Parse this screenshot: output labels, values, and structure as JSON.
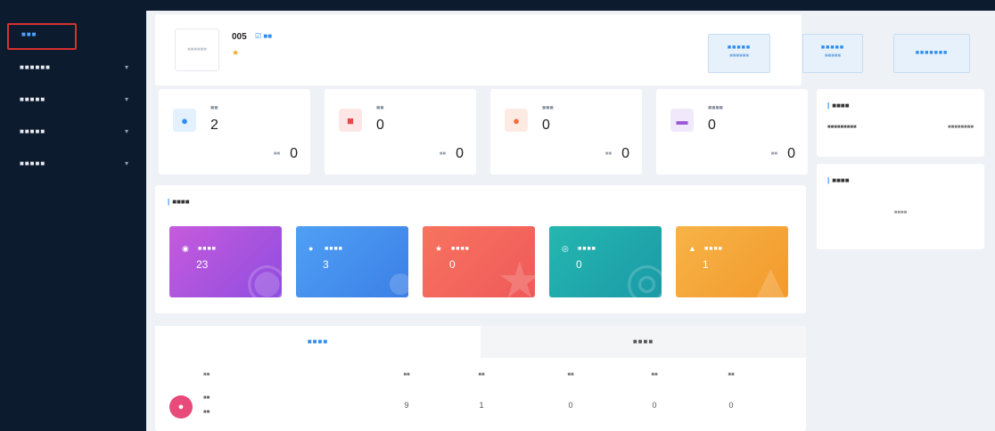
{
  "sidebar": {
    "home_label": "■■■",
    "items": [
      {
        "label": "■■■■■■",
        "chevron": "▾"
      },
      {
        "label": "■■■■■",
        "chevron": "▾"
      },
      {
        "label": "■■■■■",
        "chevron": "▾"
      },
      {
        "label": "■■■■■",
        "chevron": "▾"
      }
    ]
  },
  "shop": {
    "logo_text": "■■■■■■",
    "name": "005",
    "edit_label": "☑ ■■",
    "rating": "★"
  },
  "top_buttons": [
    {
      "line1": "■■■■■",
      "line2": "■■■■■■"
    },
    {
      "line1": "■■■■■",
      "line2": "■■■■■"
    },
    {
      "line1": "■■■■■■■",
      "line2": ""
    }
  ],
  "stats": [
    {
      "name": "■■",
      "value": "2",
      "sub_label": "■■",
      "sub_value": "0",
      "icon": "eye-icon",
      "glyph": "●",
      "color": "#2d8cf0",
      "bg": "#e3f0fd"
    },
    {
      "name": "■■",
      "value": "0",
      "sub_label": "■■",
      "sub_value": "0",
      "icon": "gift-icon",
      "glyph": "■",
      "color": "#e84a4a",
      "bg": "#fde6e6"
    },
    {
      "name": "■■■",
      "value": "0",
      "sub_label": "■■",
      "sub_value": "0",
      "icon": "user-icon",
      "glyph": "●",
      "color": "#f56b3c",
      "bg": "#fdeae3"
    },
    {
      "name": "■■■■",
      "value": "0",
      "sub_label": "■■",
      "sub_value": "0",
      "icon": "chat-icon",
      "glyph": "▬",
      "color": "#9b59d6",
      "bg": "#f1e8fb"
    }
  ],
  "system_notice": {
    "title": "■■■■",
    "row_text": "■■■■■■■■■",
    "date": "■■■■■■■■"
  },
  "contact": {
    "title": "■■■■",
    "empty_text": "■■■■"
  },
  "analysis": {
    "title": "■■■■",
    "tiles": [
      {
        "label": "■■■■",
        "value": "23",
        "icon": "eye-icon",
        "glyph": "◉",
        "grad": "linear-gradient(135deg,#c65bdc,#8f4de0)"
      },
      {
        "label": "■■■■",
        "value": "3",
        "icon": "user-icon",
        "glyph": "●",
        "grad": "linear-gradient(135deg,#4fa0f5,#3c7fe6)"
      },
      {
        "label": "■■■■",
        "value": "0",
        "icon": "star-icon",
        "glyph": "★",
        "grad": "linear-gradient(135deg,#f7735f,#ef5a5a)"
      },
      {
        "label": "■■■■",
        "value": "0",
        "icon": "share-icon",
        "glyph": "◎",
        "grad": "linear-gradient(135deg,#25b7b0,#1a9aa7)"
      },
      {
        "label": "■■■■",
        "value": "1",
        "icon": "thumb-icon",
        "glyph": "▲",
        "grad": "linear-gradient(135deg,#f7b347,#f39a2b)"
      }
    ]
  },
  "bottom_tabs": {
    "tab1": "■■■■",
    "tab2": "■■■■",
    "columns": [
      "■■",
      "■■",
      "■■",
      "■■",
      "■■",
      "■■"
    ],
    "row_label_1": "■■",
    "row_label_2": "■■",
    "values": [
      "9",
      "1",
      "0",
      "0",
      "0"
    ]
  }
}
